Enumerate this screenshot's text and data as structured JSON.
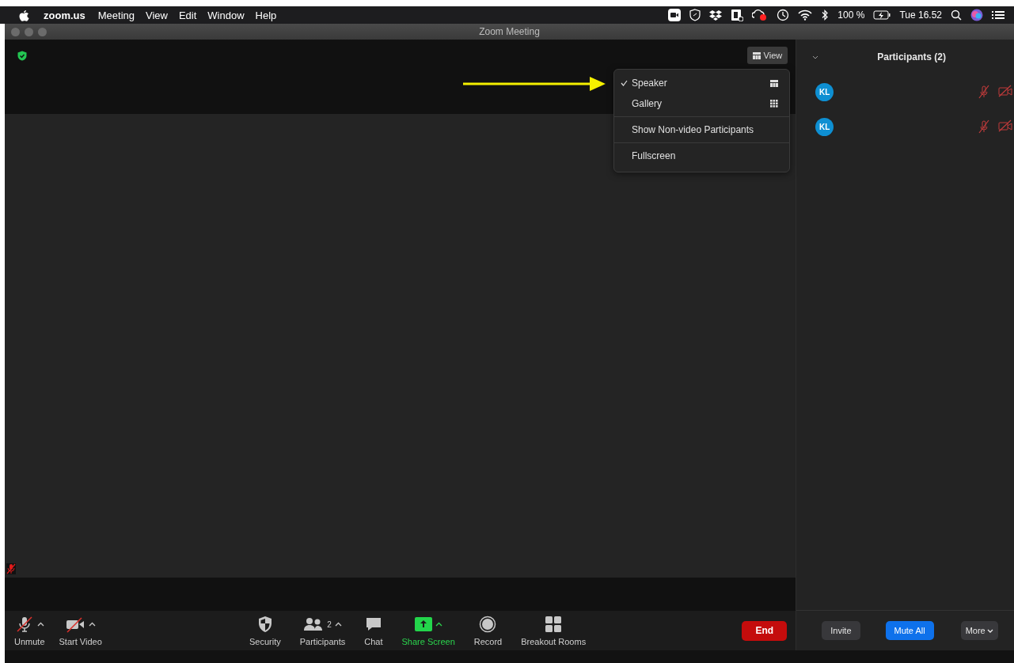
{
  "menu_bar": {
    "app": "zoom.us",
    "items": [
      "Meeting",
      "View",
      "Edit",
      "Window",
      "Help"
    ],
    "battery": "100 %",
    "clock": "Tue 16.52"
  },
  "window": {
    "title": "Zoom Meeting"
  },
  "view_button": {
    "label": "View"
  },
  "view_menu": {
    "groups": [
      [
        {
          "label": "Speaker",
          "selected": true,
          "kind": "speaker"
        },
        {
          "label": "Gallery",
          "selected": false,
          "kind": "gallery"
        }
      ],
      [
        {
          "label": "Show Non-video Participants",
          "selected": false,
          "kind": "plain"
        }
      ],
      [
        {
          "label": "Fullscreen",
          "selected": false,
          "kind": "plain"
        }
      ]
    ]
  },
  "toolbar": {
    "left": [
      {
        "label": "Unmute",
        "kind": "mic",
        "off": true,
        "caret": true
      },
      {
        "label": "Start Video",
        "kind": "video",
        "off": true,
        "caret": true
      }
    ],
    "center": [
      {
        "label": "Security",
        "kind": "security",
        "caret": false
      },
      {
        "label": "Participants",
        "kind": "participants",
        "count": "2",
        "caret": true
      },
      {
        "label": "Chat",
        "kind": "chat",
        "caret": false
      },
      {
        "label": "Share Screen",
        "kind": "share",
        "caret": true
      },
      {
        "label": "Record",
        "kind": "record",
        "caret": false
      },
      {
        "label": "Breakout Rooms",
        "kind": "breakout",
        "caret": false
      }
    ],
    "end": "End"
  },
  "participants_panel": {
    "title": "Participants (2)",
    "participants": [
      {
        "initials": "KL",
        "audio_muted": true,
        "video_off": true
      },
      {
        "initials": "KL",
        "audio_muted": true,
        "video_off": true
      }
    ],
    "buttons": [
      {
        "label": "Invite",
        "kind": "plain"
      },
      {
        "label": "Mute All",
        "kind": "primary"
      },
      {
        "label": "More",
        "kind": "dropdown"
      }
    ]
  }
}
